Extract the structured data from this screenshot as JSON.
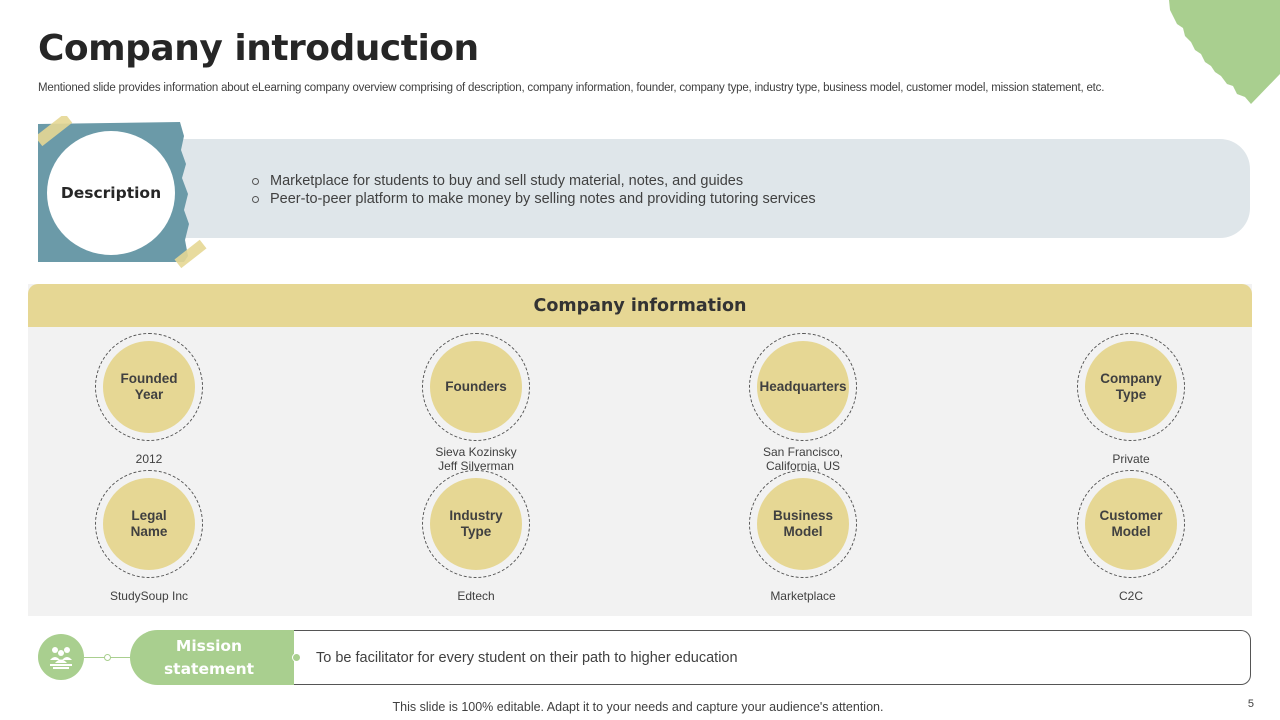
{
  "slide": {
    "title": "Company introduction",
    "subtitle": "Mentioned slide provides information about eLearning company overview comprising of description, company information, founder, company type, industry type,  business model, customer model, mission statement, etc.",
    "page_number": "5",
    "footer": "This slide is 100% editable. Adapt it to your needs and capture your audience's attention."
  },
  "description": {
    "label": "Description",
    "points": [
      "Marketplace for students to buy and sell study material, notes, and guides",
      "Peer-to-peer platform to make money by selling notes and providing tutoring services"
    ]
  },
  "company_info": {
    "header": "Company information",
    "items": [
      {
        "label": "Founded\nYear",
        "value": "2012"
      },
      {
        "label": "Founders",
        "value": "Sieva Kozinsky\nJeff Silverman"
      },
      {
        "label": "Headquarters",
        "value": "San Francisco,\nCalifornia, US"
      },
      {
        "label": "Company\nType",
        "value": "Private"
      },
      {
        "label": "Legal\nName",
        "value": "StudySoup Inc"
      },
      {
        "label": "Industry\nType",
        "value": "Edtech"
      },
      {
        "label": "Business\nModel",
        "value": "Marketplace"
      },
      {
        "label": "Customer\nModel",
        "value": "C2C"
      }
    ]
  },
  "mission": {
    "label": "Mission\nstatement",
    "text": "To be facilitator for every student on their path to higher education",
    "icon": "people-group-icon"
  },
  "colors": {
    "accent_green": "#a9cf8f",
    "accent_yellow": "#e6d794",
    "teal_paper": "#6b9aa8",
    "desc_panel": "#dfe6ea"
  }
}
